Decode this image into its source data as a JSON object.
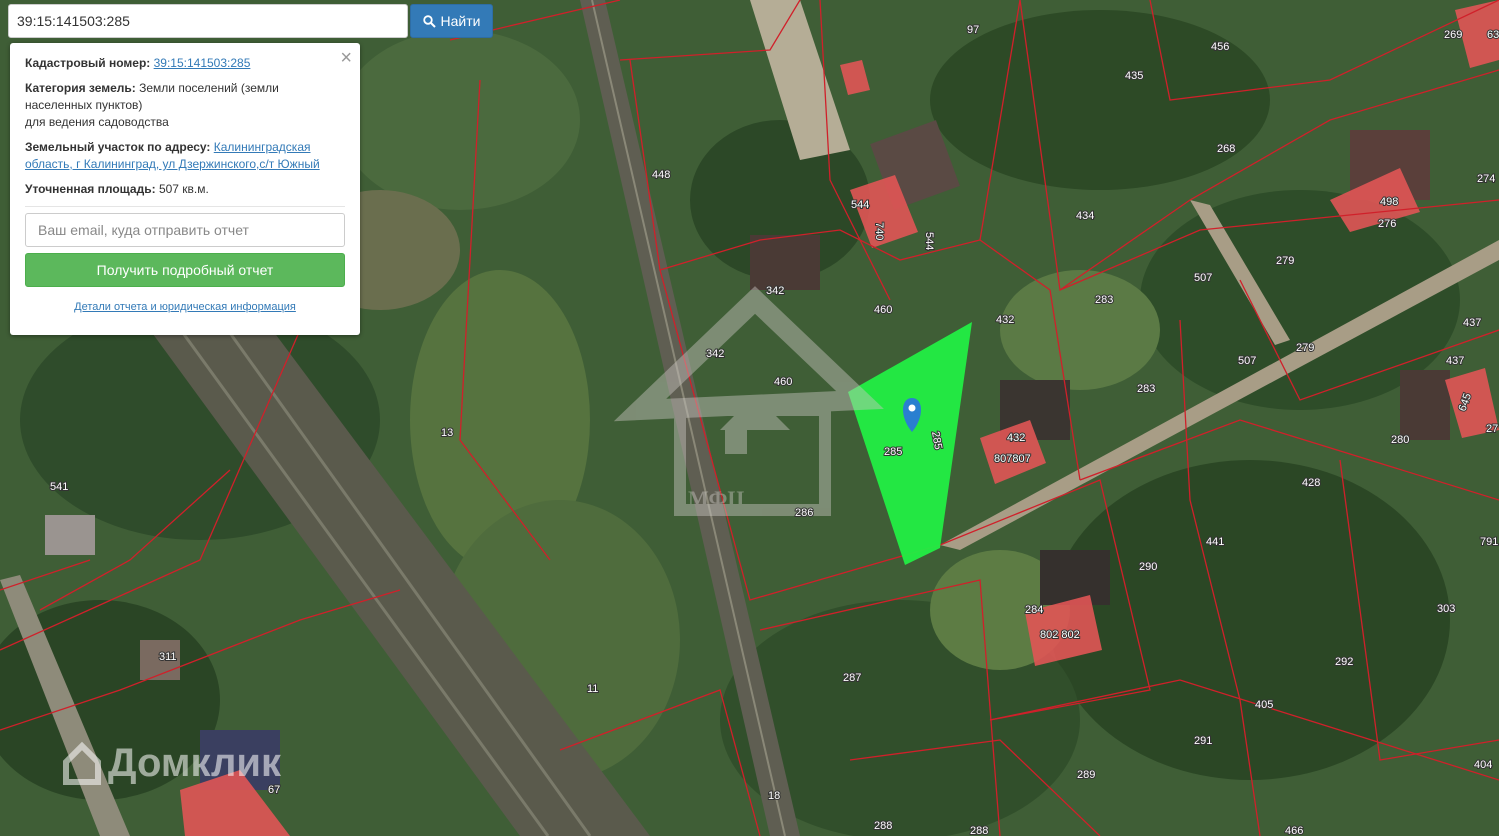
{
  "search": {
    "value": "39:15:141503:285",
    "button_label": "Найти",
    "button_icon": "search-icon"
  },
  "info": {
    "close_glyph": "×",
    "cadastral_label": "Кадастровый номер:",
    "cadastral_value": "39:15:141503:285",
    "category_label": "Категория земель:",
    "category_value": "Земли поселений (земли населенных пунктов)",
    "category_purpose": "для ведения садоводства",
    "address_label": "Земельный участок по адресу:",
    "address_value": "Калининградская область, г Калининград, ул Дзержинского,с/т Южный",
    "area_label": "Уточненная площадь:",
    "area_value": "507 кв.м.",
    "email_placeholder": "Ваш email, куда отправить отчет",
    "report_button": "Получить подробный отчет",
    "details_link": "Детали отчета и юридическая информация"
  },
  "map": {
    "selected_parcel_color": "#22ee44",
    "boundary_color": "#d0202a",
    "building_color": "#e05555",
    "watermarks": [
      "МФЦ",
      "Домклик"
    ],
    "labels": [
      "97",
      "456",
      "435",
      "269",
      "63",
      "268",
      "274",
      "498",
      "276",
      "448",
      "544",
      "740",
      "544",
      "434",
      "283",
      "507",
      "279",
      "342",
      "460",
      "432",
      "342",
      "460",
      "283",
      "507",
      "279",
      "437",
      "437",
      "645",
      "280",
      "27",
      "285",
      "285",
      "432",
      "807807",
      "428",
      "13",
      "541",
      "286",
      "441",
      "290",
      "791",
      "284",
      "802 802",
      "303",
      "311",
      "292",
      "11",
      "287",
      "405",
      "291",
      "67",
      "289",
      "18",
      "288",
      "288",
      "466",
      "404"
    ]
  }
}
